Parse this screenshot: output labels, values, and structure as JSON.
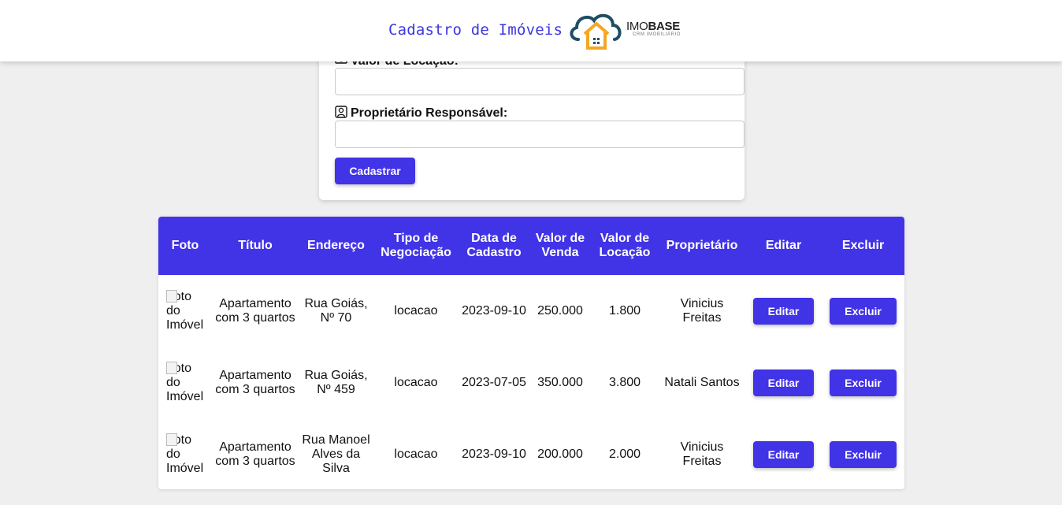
{
  "header": {
    "title": "Cadastro de Imóveis",
    "logo_text_light": "IMO",
    "logo_text_bold": "BASE",
    "logo_sub": "CRM IMOBILIÁRIO"
  },
  "form": {
    "rent_label": "Valor de Locação:",
    "owner_label": "Proprietário Responsável:",
    "submit_label": "Cadastrar",
    "rent_value": "",
    "owner_value": ""
  },
  "table": {
    "headers": [
      "Foto",
      "Título",
      "Endereço",
      "Tipo de Negociação",
      "Data de Cadastro",
      "Valor de Venda",
      "Valor de Locação",
      "Proprietário",
      "Editar",
      "Excluir"
    ],
    "rows": [
      {
        "photo_alt": "Foto do Imóvel",
        "title": "Apartamento com 3 quartos",
        "address": "Rua Goiás, Nº 70",
        "type": "locacao",
        "date": "2023-09-10",
        "sale": "250.000",
        "rent": "1.800",
        "owner": "Vinicius Freitas",
        "edit": "Editar",
        "delete": "Excluir"
      },
      {
        "photo_alt": "Foto do Imóvel",
        "title": "Apartamento com 3 quartos",
        "address": "Rua Goiás, Nº 459",
        "type": "locacao",
        "date": "2023-07-05",
        "sale": "350.000",
        "rent": "3.800",
        "owner": "Natali Santos",
        "edit": "Editar",
        "delete": "Excluir"
      },
      {
        "photo_alt": "Foto do Imóvel",
        "title": "Apartamento com 3 quartos",
        "address": "Rua Manoel Alves da Silva",
        "type": "locacao",
        "date": "2023-09-10",
        "sale": "200.000",
        "rent": "2.000",
        "owner": "Vinicius Freitas",
        "edit": "Editar",
        "delete": "Excluir"
      }
    ]
  },
  "colors": {
    "accent": "#4133e6",
    "logo_cloud": "#1f4e63",
    "logo_house": "#f5a623"
  }
}
